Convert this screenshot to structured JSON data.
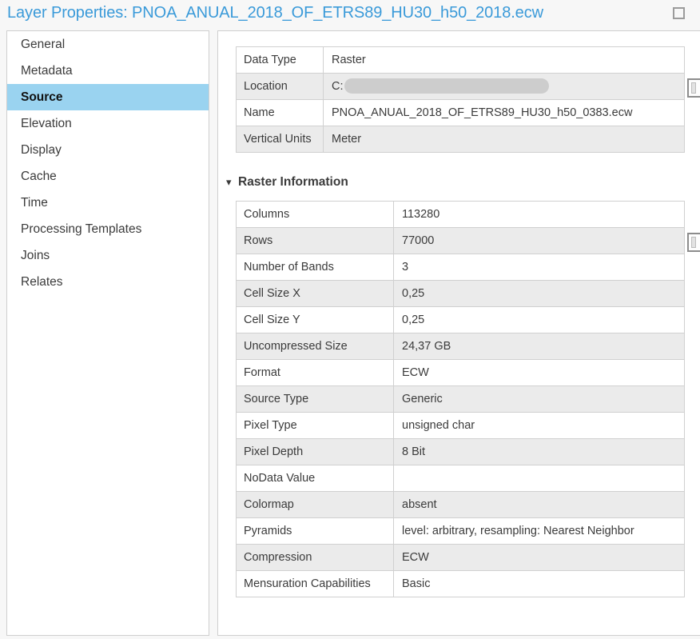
{
  "window": {
    "title": "Layer Properties: PNOA_ANUAL_2018_OF_ETRS89_HU30_h50_2018.ecw",
    "maximize_icon": "maximize-square-icon",
    "title_color": "#3a9ad9"
  },
  "sidebar": {
    "items": [
      {
        "label": "General",
        "selected": false
      },
      {
        "label": "Metadata",
        "selected": false
      },
      {
        "label": "Source",
        "selected": true
      },
      {
        "label": "Elevation",
        "selected": false
      },
      {
        "label": "Display",
        "selected": false
      },
      {
        "label": "Cache",
        "selected": false
      },
      {
        "label": "Time",
        "selected": false
      },
      {
        "label": "Processing Templates",
        "selected": false
      },
      {
        "label": "Joins",
        "selected": false
      },
      {
        "label": "Relates",
        "selected": false
      }
    ],
    "selected_background": "#9ad3f0"
  },
  "source_table": {
    "rows": [
      {
        "key": "Data Type",
        "value": "Raster",
        "redacted": false
      },
      {
        "key": "Location",
        "value": "C:",
        "redacted": true
      },
      {
        "key": "Name",
        "value": "PNOA_ANUAL_2018_OF_ETRS89_HU30_h50_0383.ecw",
        "redacted": false
      },
      {
        "key": "Vertical Units",
        "value": "Meter",
        "redacted": false
      }
    ]
  },
  "raster_section": {
    "chevron": "chevron-down-icon",
    "label": "Raster Information",
    "expanded": true
  },
  "raster_table": {
    "rows": [
      {
        "key": "Columns",
        "value": "113280"
      },
      {
        "key": "Rows",
        "value": "77000"
      },
      {
        "key": "Number of Bands",
        "value": "3"
      },
      {
        "key": "Cell Size X",
        "value": "0,25"
      },
      {
        "key": "Cell Size Y",
        "value": "0,25"
      },
      {
        "key": "Uncompressed Size",
        "value": "24,37 GB"
      },
      {
        "key": "Format",
        "value": "ECW"
      },
      {
        "key": "Source Type",
        "value": "Generic"
      },
      {
        "key": "Pixel Type",
        "value": "unsigned char"
      },
      {
        "key": "Pixel Depth",
        "value": "8 Bit"
      },
      {
        "key": "NoData Value",
        "value": ""
      },
      {
        "key": "Colormap",
        "value": "absent"
      },
      {
        "key": "Pyramids",
        "value": "level: arbitrary, resampling: Nearest Neighbor"
      },
      {
        "key": "Compression",
        "value": "ECW"
      },
      {
        "key": "Mensuration Capabilities",
        "value": "Basic"
      }
    ]
  },
  "side_buttons": [
    {
      "name": "copy-source-properties-button"
    },
    {
      "name": "copy-raster-properties-button"
    }
  ]
}
